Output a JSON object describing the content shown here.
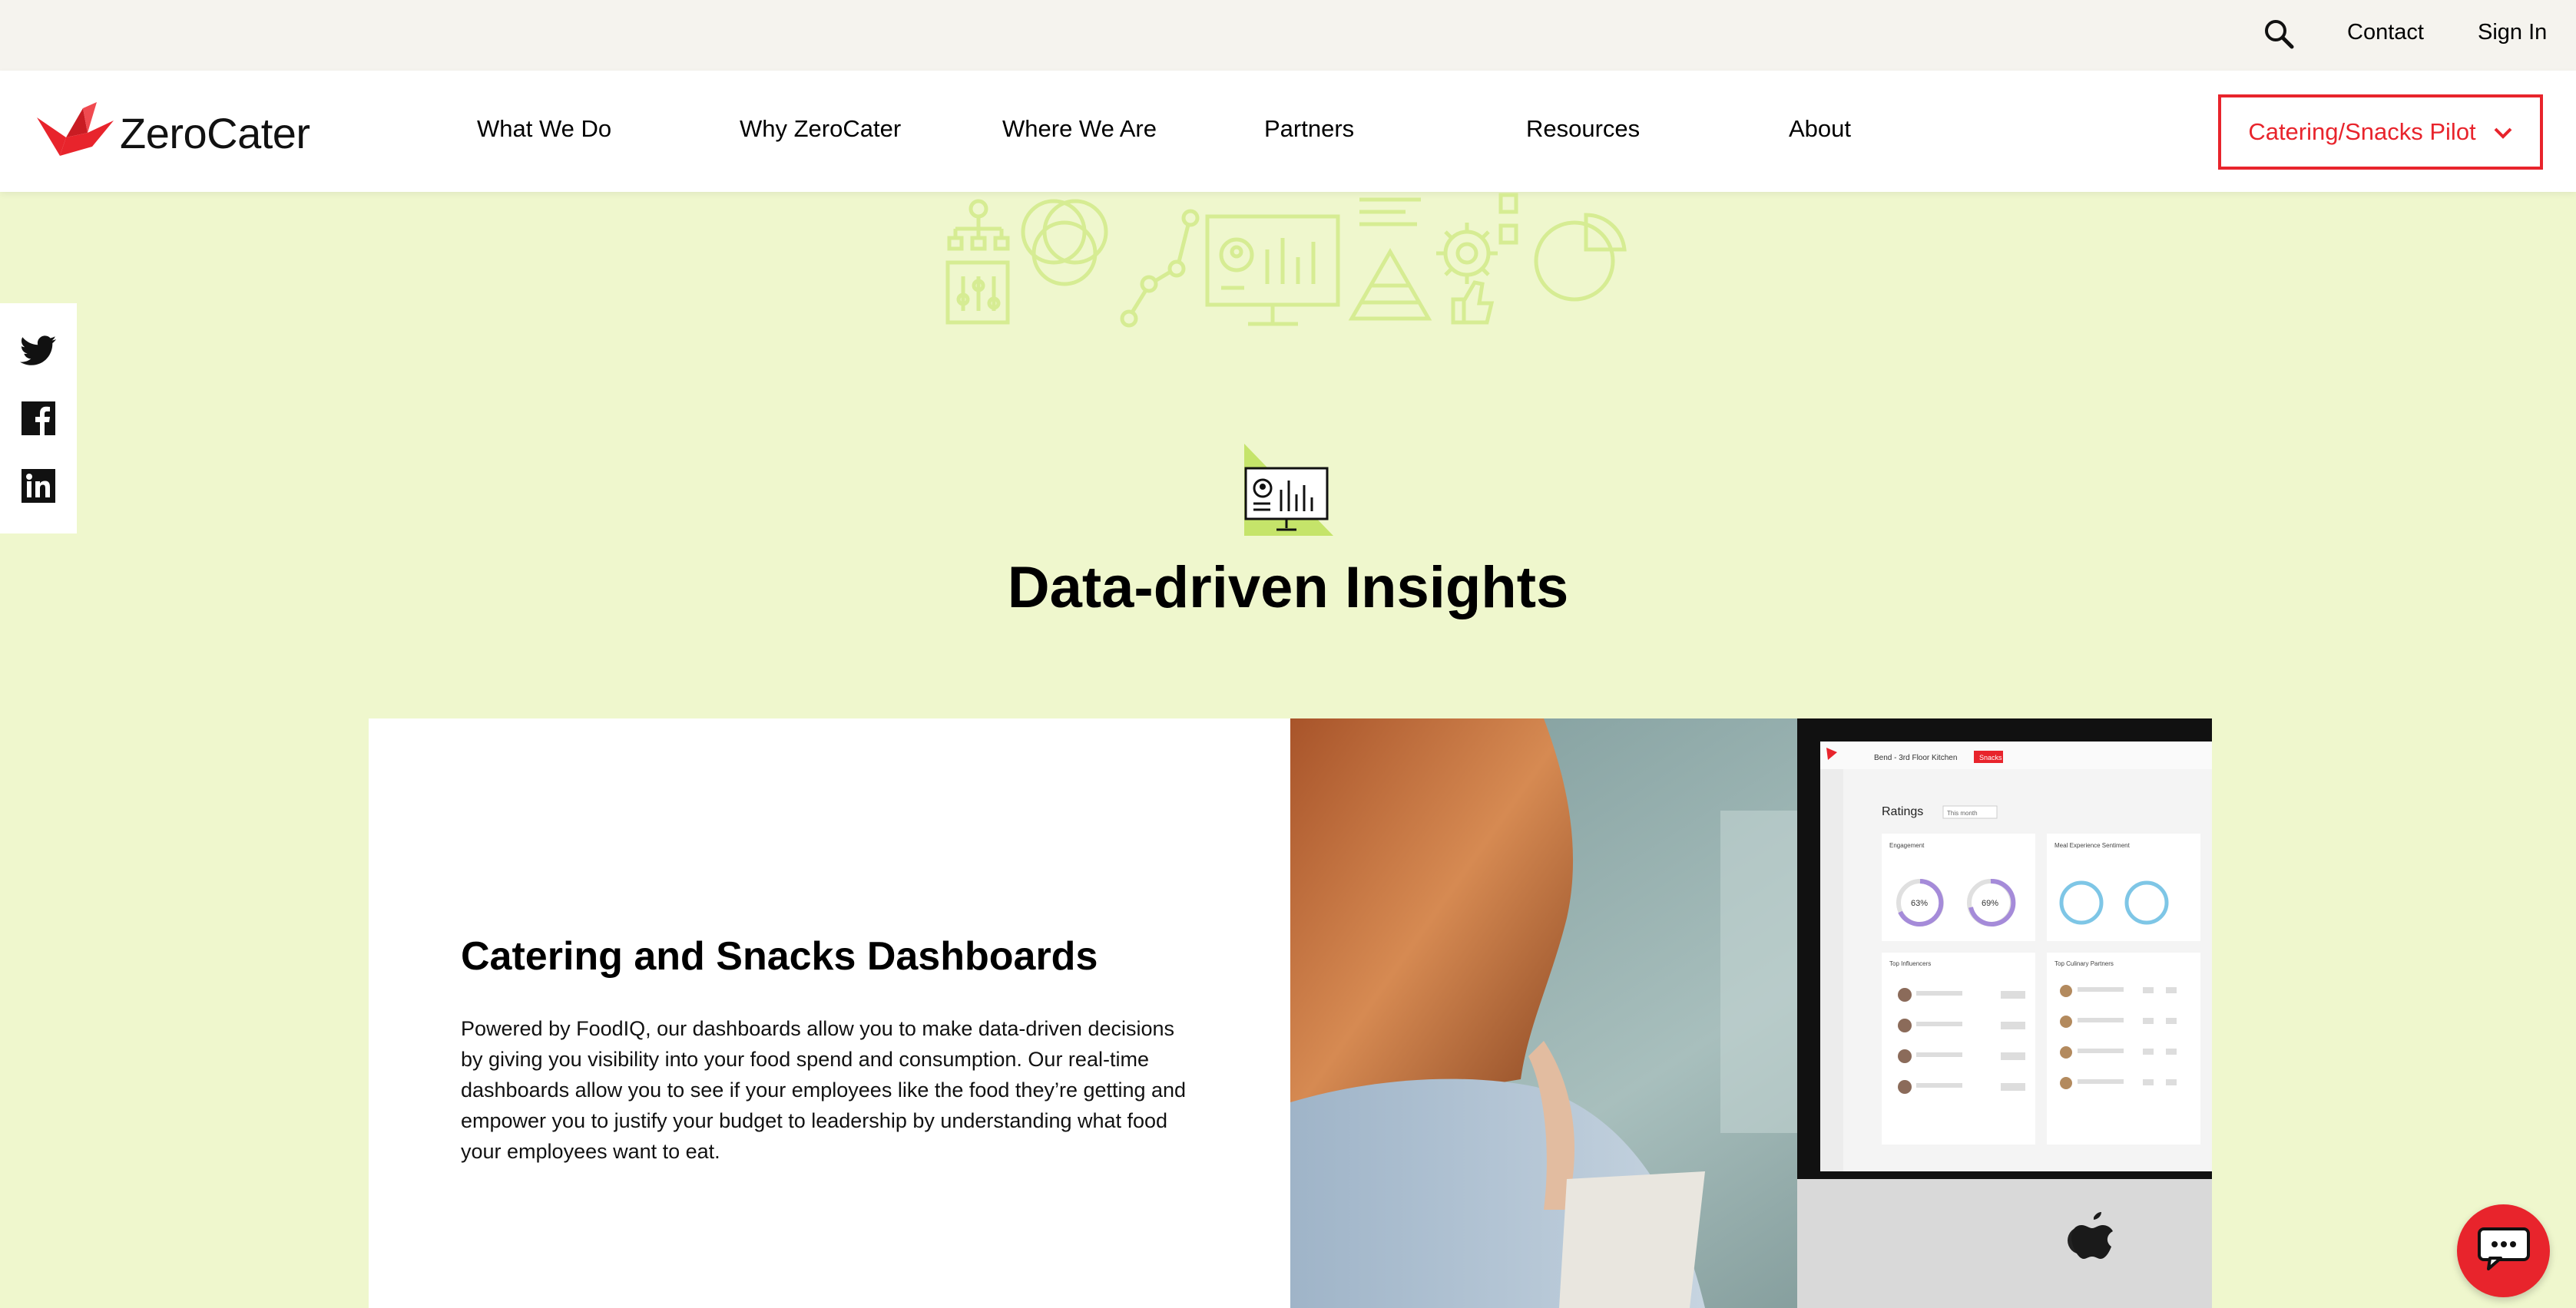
{
  "utility": {
    "contact": "Contact",
    "sign_in": "Sign In"
  },
  "brand": {
    "name": "ZeroCater",
    "accent": "#e8242c",
    "background": "#eff7cd"
  },
  "nav": {
    "items": [
      {
        "label": "What We Do"
      },
      {
        "label": "Why ZeroCater"
      },
      {
        "label": "Where We Are"
      },
      {
        "label": "Partners"
      },
      {
        "label": "Resources"
      },
      {
        "label": "About"
      }
    ],
    "pilot_button": "Catering/Snacks Pilot"
  },
  "social": [
    "twitter-icon",
    "facebook-icon",
    "linkedin-icon"
  ],
  "section": {
    "title": "Data-driven Insights",
    "icon": "dashboard-monitor-icon"
  },
  "card": {
    "title": "Catering and Snacks Dashboards",
    "body": "Powered by FoodIQ, our dashboards allow you to make data-driven decisions by giving you visibility into your food spend and consumption. Our real-time dashboards allow you to see if your employees like the food they’re getting and empower you to justify your budget to leadership by understanding what food your employees want to eat."
  },
  "dashboard_screen": {
    "location": "Bend - 3rd Floor Kitchen",
    "button": "Snacks",
    "heading": "Ratings",
    "filter": "This month",
    "engagement_label": "Engagement",
    "engagement_values": [
      "63%",
      "69%"
    ],
    "sentiment_label": "Meal Experience Sentiment",
    "influencers_label": "Top Influencers",
    "partners_label": "Top Culinary Partners"
  }
}
